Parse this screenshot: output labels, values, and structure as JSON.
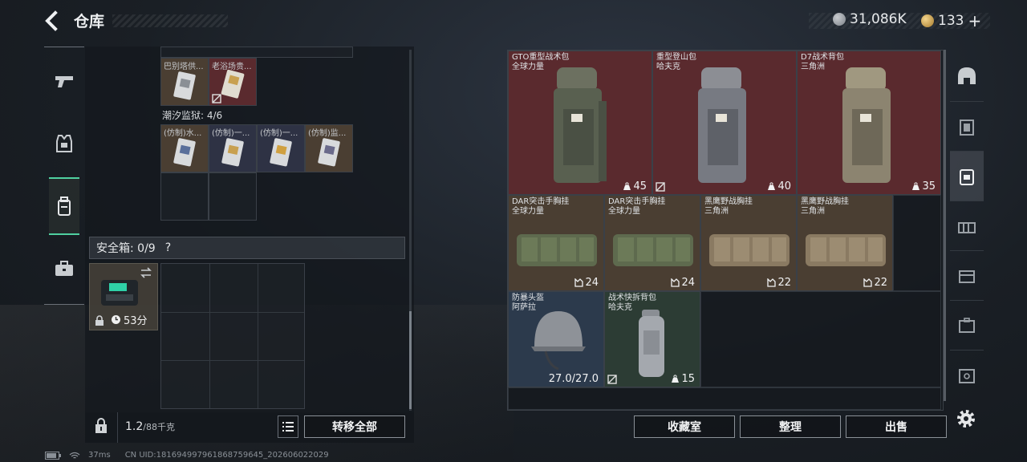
{
  "header": {
    "title": "仓库"
  },
  "currency": {
    "silver": "31,086K",
    "gold": "133",
    "gold_plus": "+"
  },
  "left": {
    "top_cards": [
      {
        "label": "巴别塔供..."
      },
      {
        "label": "老浴场贵..."
      }
    ],
    "section_title": "潮汐监狱: 4/6",
    "section_cards": [
      {
        "label": "(仿制)水..."
      },
      {
        "label": "(仿制)一..."
      },
      {
        "label": "(仿制)一..."
      },
      {
        "label": "(仿制)监..."
      }
    ],
    "safe": {
      "label": "安全箱: 0/9",
      "help": "?",
      "timer": "53分"
    },
    "weight": {
      "current": "1.2",
      "max": "/88千克"
    },
    "transfer_all": "转移全部"
  },
  "items": [
    {
      "name": "GTO重型战术包",
      "sub": "全球力量",
      "stat": "45"
    },
    {
      "name": "重型登山包",
      "sub": "哈夫克",
      "stat": "40"
    },
    {
      "name": "D7战术背包",
      "sub": "三角洲",
      "stat": "35"
    },
    {
      "name": "DAR突击手胸挂",
      "sub": "全球力量",
      "stat": "24"
    },
    {
      "name": "DAR突击手胸挂",
      "sub": "全球力量",
      "stat": "24"
    },
    {
      "name": "黑鹰野战胸挂",
      "sub": "三角洲",
      "stat": "22"
    },
    {
      "name": "黑鹰野战胸挂",
      "sub": "三角洲",
      "stat": "22"
    },
    {
      "name": "防暴头盔",
      "sub": "阿萨拉",
      "stat": "27.0/27.0"
    },
    {
      "name": "战术快拆背包",
      "sub": "哈夫克",
      "stat": "15"
    }
  ],
  "bottom_buttons": {
    "collection": "收藏室",
    "organize": "整理",
    "sell": "出售"
  },
  "status": {
    "ping": "37ms",
    "uid": "CN UID:18169499796186875964​5_202606022029"
  },
  "colors": {
    "accent": "#4fd0a0",
    "red_cell": "#5a2a2e",
    "brown_cell": "#4a3e32",
    "blue_cell": "#2c3a4c",
    "green_cell": "#2c3c34"
  },
  "icons": {
    "left_nav": [
      "pistol-icon",
      "vest-icon",
      "backpack-icon",
      "briefcase-icon"
    ],
    "right_nav": [
      "helmet-icon",
      "armor-tier-icon",
      "backpack-tier-icon",
      "chest-rig-icon",
      "container-icon",
      "case-icon",
      "safe-box-icon"
    ]
  }
}
